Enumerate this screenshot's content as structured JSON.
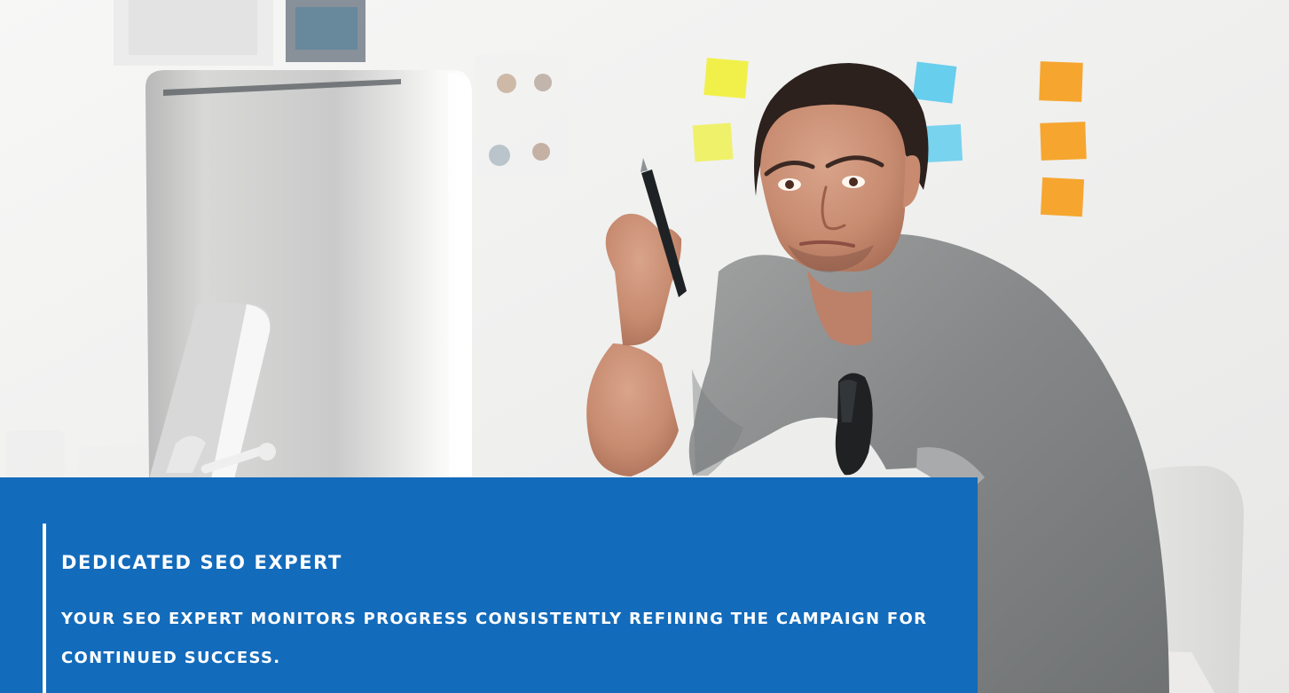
{
  "hero": {
    "image_subject": "man-at-computer-photo",
    "colors": {
      "caption_background": "#136bbb",
      "caption_text": "#ffffff",
      "wall": "#f4f4f3",
      "monitor": "#d8d9d8",
      "shirt": "#8c8e8f",
      "sticky_yellow": "#f1ef38",
      "sticky_blue": "#39c3ec",
      "sticky_orange": "#f6a124"
    }
  },
  "caption": {
    "title": "DEDICATED SEO EXPERT",
    "text": "YOUR SEO EXPERT MONITORS PROGRESS CONSISTENTLY REFINING THE CAMPAIGN FOR CONTINUED SUCCESS."
  }
}
